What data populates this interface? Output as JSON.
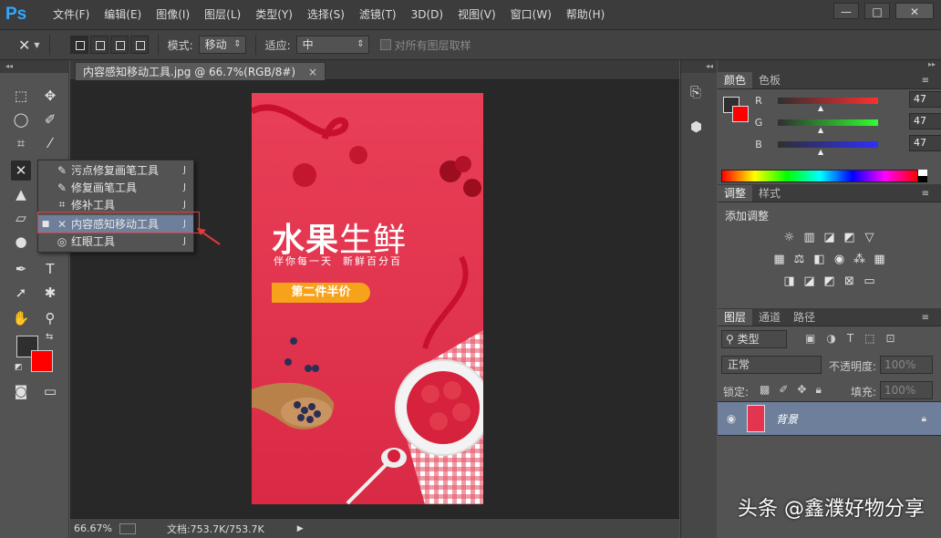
{
  "app": {
    "logo": "Ps"
  },
  "menu": [
    "文件(F)",
    "编辑(E)",
    "图像(I)",
    "图层(L)",
    "类型(Y)",
    "选择(S)",
    "滤镜(T)",
    "3D(D)",
    "视图(V)",
    "窗口(W)",
    "帮助(H)"
  ],
  "window": {
    "minimize": "—",
    "restore": "□",
    "close": "✕"
  },
  "options": {
    "mode_label": "模式:",
    "mode_value": "移动",
    "adapt_label": "适应:",
    "adapt_value": "中",
    "sample_all_label": "对所有图层取样"
  },
  "document": {
    "tab_title": "内容感知移动工具.jpg @ 66.7%(RGB/8#)",
    "close": "×"
  },
  "status": {
    "zoom": "66.67%",
    "doc_info": "文档:753.7K/753.7K",
    "arrow": "▶"
  },
  "flyout": {
    "items": [
      {
        "label": "污点修复画笔工具",
        "key": "J",
        "icon": "spot-healing-icon",
        "glyph": "✎"
      },
      {
        "label": "修复画笔工具",
        "key": "J",
        "icon": "healing-brush-icon",
        "glyph": "✎"
      },
      {
        "label": "修补工具",
        "key": "J",
        "icon": "patch-icon",
        "glyph": "⌗"
      },
      {
        "label": "内容感知移动工具",
        "key": "J",
        "icon": "content-aware-move-icon",
        "glyph": "✕",
        "selected": true
      },
      {
        "label": "红眼工具",
        "key": "J",
        "icon": "red-eye-icon",
        "glyph": "◎"
      }
    ]
  },
  "canvas": {
    "title_a": "水果",
    "title_b": "生鲜",
    "subtitle": "伴你每一天  新鲜百分百",
    "badge": "第二件半价",
    "bg_color": "#e33450",
    "badge_color": "#f7a21b"
  },
  "color_panel": {
    "tabs": [
      "颜色",
      "色板"
    ],
    "channels": [
      {
        "name": "R",
        "value": "47"
      },
      {
        "name": "G",
        "value": "47"
      },
      {
        "name": "B",
        "value": "47"
      }
    ],
    "fg_color": "#2f2f2f",
    "bg_color": "#ff0000"
  },
  "adjust_panel": {
    "tabs": [
      "调整",
      "样式"
    ],
    "heading": "添加调整"
  },
  "layers_panel": {
    "tabs": [
      "图层",
      "通道",
      "路径"
    ],
    "filter": "类型",
    "blend": "正常",
    "opacity_label": "不透明度:",
    "opacity_value": "100%",
    "lock_label": "锁定:",
    "fill_label": "填充:",
    "fill_value": "100%",
    "layer_name": "背景"
  },
  "watermark": "头条 @鑫濮好物分享"
}
